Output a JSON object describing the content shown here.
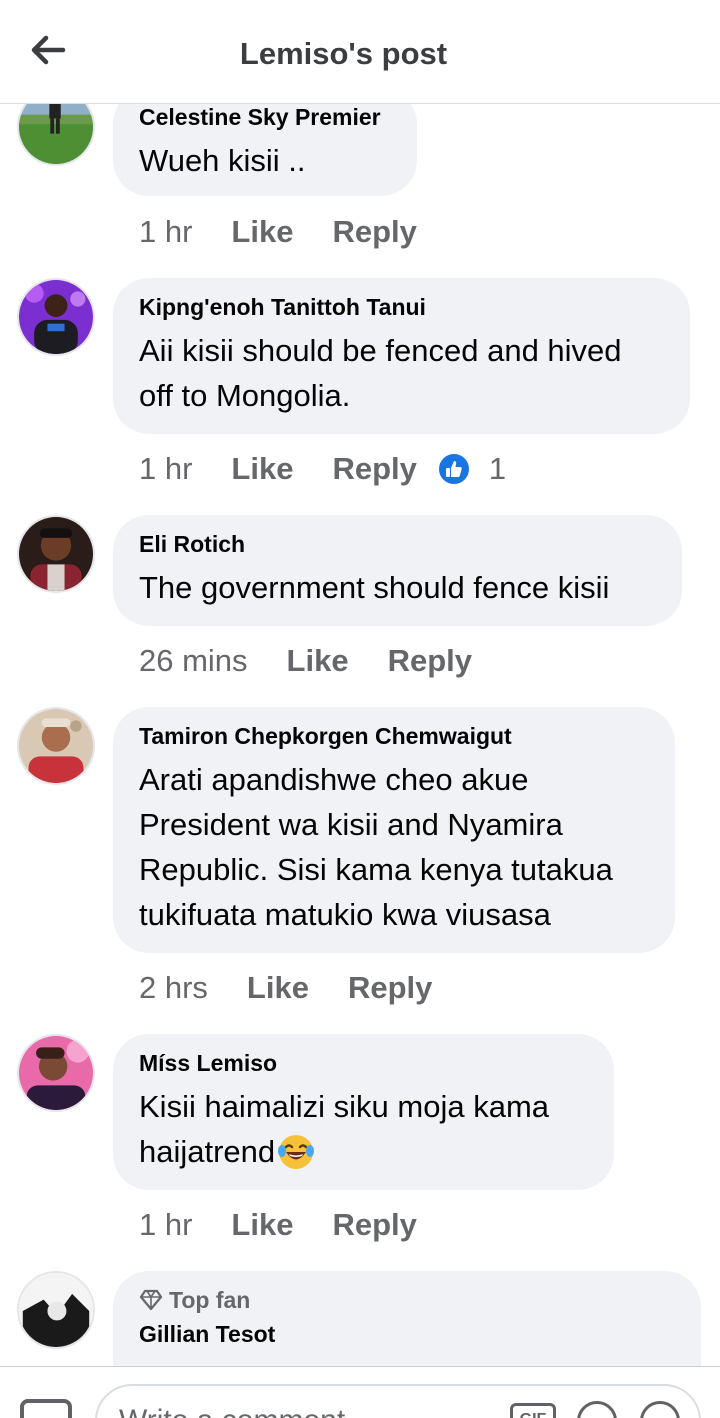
{
  "header": {
    "title": "Lemiso's post",
    "back_icon": "arrow-left-icon"
  },
  "comments": [
    {
      "author": "Celestine Sky Premier",
      "lines": [
        "Wueh kisii .."
      ],
      "time": "1 hr",
      "like_label": "Like",
      "reply_label": "Reply"
    },
    {
      "author": "Kipng'enoh Tanittoh Tanui",
      "lines": [
        "Aii kisii should be fenced and hived",
        "off to Mongolia."
      ],
      "time": "1 hr",
      "like_label": "Like",
      "reply_label": "Reply",
      "reaction_icon": "thumbs-up-icon",
      "reaction_count": "1"
    },
    {
      "author": "Eli Rotich",
      "lines": [
        "The government should fence kisii"
      ],
      "time": "26 mins",
      "like_label": "Like",
      "reply_label": "Reply"
    },
    {
      "author": "Tamiron Chepkorgen Chemwaigut",
      "lines": [
        "Arati apandishwe cheo akue",
        "President wa kisii and Nyamira",
        "Republic. Sisi kama kenya tutakua",
        "tukifuata matukio kwa viusasa"
      ],
      "time": "2 hrs",
      "like_label": "Like",
      "reply_label": "Reply"
    },
    {
      "author": "Míss Lemiso",
      "lines": [
        "Kisii haimalizi siku moja kama",
        "haijatrend"
      ],
      "emoji_icon": "laughing-tears-emoji-icon",
      "time": "1 hr",
      "like_label": "Like",
      "reply_label": "Reply"
    },
    {
      "badge": "Top fan",
      "badge_icon": "diamond-icon",
      "author": "Gillian Tesot"
    }
  ],
  "composer": {
    "placeholder": "Write a comment…",
    "photo_icon": "photo-icon",
    "gif_label": "GIF",
    "sticker_icon": "sticker-icon",
    "emoji_icon": "emoji-icon"
  },
  "colors": {
    "bubble": "#f0f2f5",
    "meta_text": "#65676b",
    "like_blue": "#1b74e4"
  }
}
